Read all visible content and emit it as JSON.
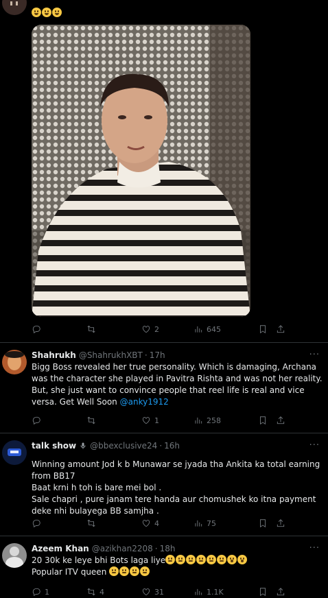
{
  "top_tweet": {
    "text_emojis": [
      "laughing-emoji",
      "laughing-emoji",
      "laughing-emoji"
    ],
    "actions": {
      "replies": "",
      "retweets": "",
      "likes": "2",
      "views": "645"
    }
  },
  "replies": [
    {
      "name": "Shahrukh",
      "handle": "@ShahrukhXBT",
      "time": "17h",
      "text_lines": [
        "Bigg Boss revealed her true personality. Which is damaging, Archana was the character she played in Pavitra Rishta and was not her reality. But, she just want to convince people that reel life is real and vice versa. Get Well Soon "
      ],
      "mention": "@anky1912",
      "actions": {
        "replies": "",
        "retweets": "",
        "likes": "1",
        "views": "258"
      }
    },
    {
      "name": "talk show",
      "handle": "@bbexclusive24",
      "time": "16h",
      "text_lines": [
        "Winning amount Jod k b Munawar se jyada tha Ankita ka total earning from BB17",
        "Baat krni h toh is bare mei bol .",
        "Sale chapri , pure janam tere handa aur chomushek ko itna payment deke nhi bulayega BB samjha ."
      ],
      "actions": {
        "replies": "",
        "retweets": "",
        "likes": "4",
        "views": "75"
      }
    },
    {
      "name": "Azeem Khan",
      "handle": "@azikhan2208",
      "time": "18h",
      "text_lines": [
        "20 30k ke leye bhi Bots laga liye",
        "Popular ITV queen "
      ],
      "actions": {
        "replies": "1",
        "retweets": "4",
        "likes": "31",
        "views": "1.1K"
      }
    }
  ],
  "colors": {
    "background": "#000000",
    "text": "#e7e9ea",
    "muted": "#71767b",
    "link": "#1d9bf0",
    "divider": "#2f3336"
  }
}
